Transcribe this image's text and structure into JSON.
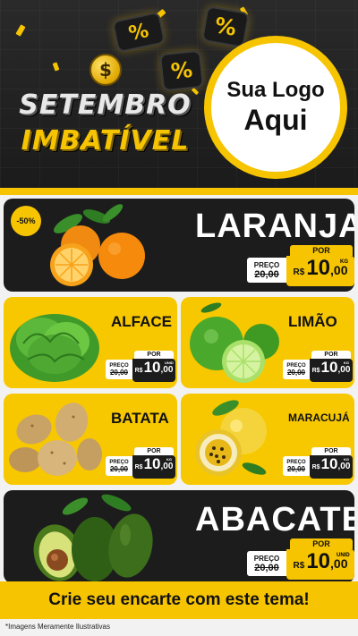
{
  "header": {
    "title_line1": "SETEMBRO",
    "title_line2": "IMBATÍVEL",
    "coin_symbol": "$",
    "percent_symbol": "%",
    "logo_line1": "Sua Logo",
    "logo_line2": "Aqui"
  },
  "colors": {
    "accent": "#f6c400",
    "dark": "#1c1c1c",
    "light": "#f2f2f2"
  },
  "products": [
    {
      "name": "LARANJA",
      "discount": "-50%",
      "por": "POR",
      "preco_label": "PREÇO",
      "old_price": "R$ 20,00",
      "old_display": "20,00",
      "currency": "R$",
      "price_int": "10",
      "price_dec": ",00",
      "unit": "KG",
      "icon": "orange-icon"
    },
    {
      "name": "ALFACE",
      "por": "POR",
      "preco_label": "PREÇO",
      "old_display": "20,00",
      "currency": "R$",
      "price_int": "10",
      "price_dec": ",00",
      "unit": "UNID",
      "icon": "lettuce-icon"
    },
    {
      "name": "LIMÃO",
      "por": "POR",
      "preco_label": "PREÇO",
      "old_display": "20,00",
      "currency": "R$",
      "price_int": "10",
      "price_dec": ",00",
      "unit": "KG",
      "icon": "lime-icon"
    },
    {
      "name": "BATATA",
      "por": "POR",
      "preco_label": "PREÇO",
      "old_display": "20,00",
      "currency": "R$",
      "price_int": "10",
      "price_dec": ",00",
      "unit": "KG",
      "icon": "potato-icon"
    },
    {
      "name": "MARACUJÁ",
      "por": "POR",
      "preco_label": "PREÇO",
      "old_display": "20,00",
      "currency": "R$",
      "price_int": "10",
      "price_dec": ",00",
      "unit": "KG",
      "icon": "passionfruit-icon"
    },
    {
      "name": "ABACATE",
      "por": "POR",
      "preco_label": "PREÇO",
      "old_display": "20,00",
      "currency": "R$",
      "price_int": "10",
      "price_dec": ",00",
      "unit": "UNID",
      "icon": "avocado-icon"
    }
  ],
  "banner": {
    "text": "Crie seu encarte com este tema!"
  },
  "footnote": {
    "text": "*Imagens Meramente Ilustrativas"
  }
}
